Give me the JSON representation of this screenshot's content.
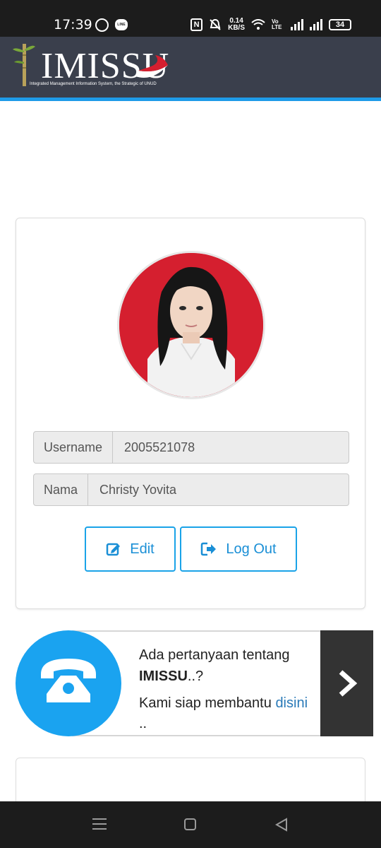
{
  "status_bar": {
    "time": "17:39",
    "network_speed_value": "0.14",
    "network_speed_unit": "KB/S",
    "volte_label": "Vo LTE",
    "battery": "34"
  },
  "header": {
    "logo_text": "IMISSU",
    "logo_tagline": "Integrated Management Information System, the Strategic of UNUD",
    "accent_color": "#1e9be8"
  },
  "profile": {
    "username_label": "Username",
    "username_value": "2005521078",
    "name_label": "Nama",
    "name_value": "Christy Yovita",
    "edit_label": "Edit",
    "logout_label": "Log Out"
  },
  "help": {
    "question_prefix": "Ada pertanyaan tentang",
    "question_brand": "IMISSU",
    "question_suffix": "..?",
    "offer_text": "Kami siap membantu",
    "link_text": "disini",
    "trailing": ".."
  }
}
